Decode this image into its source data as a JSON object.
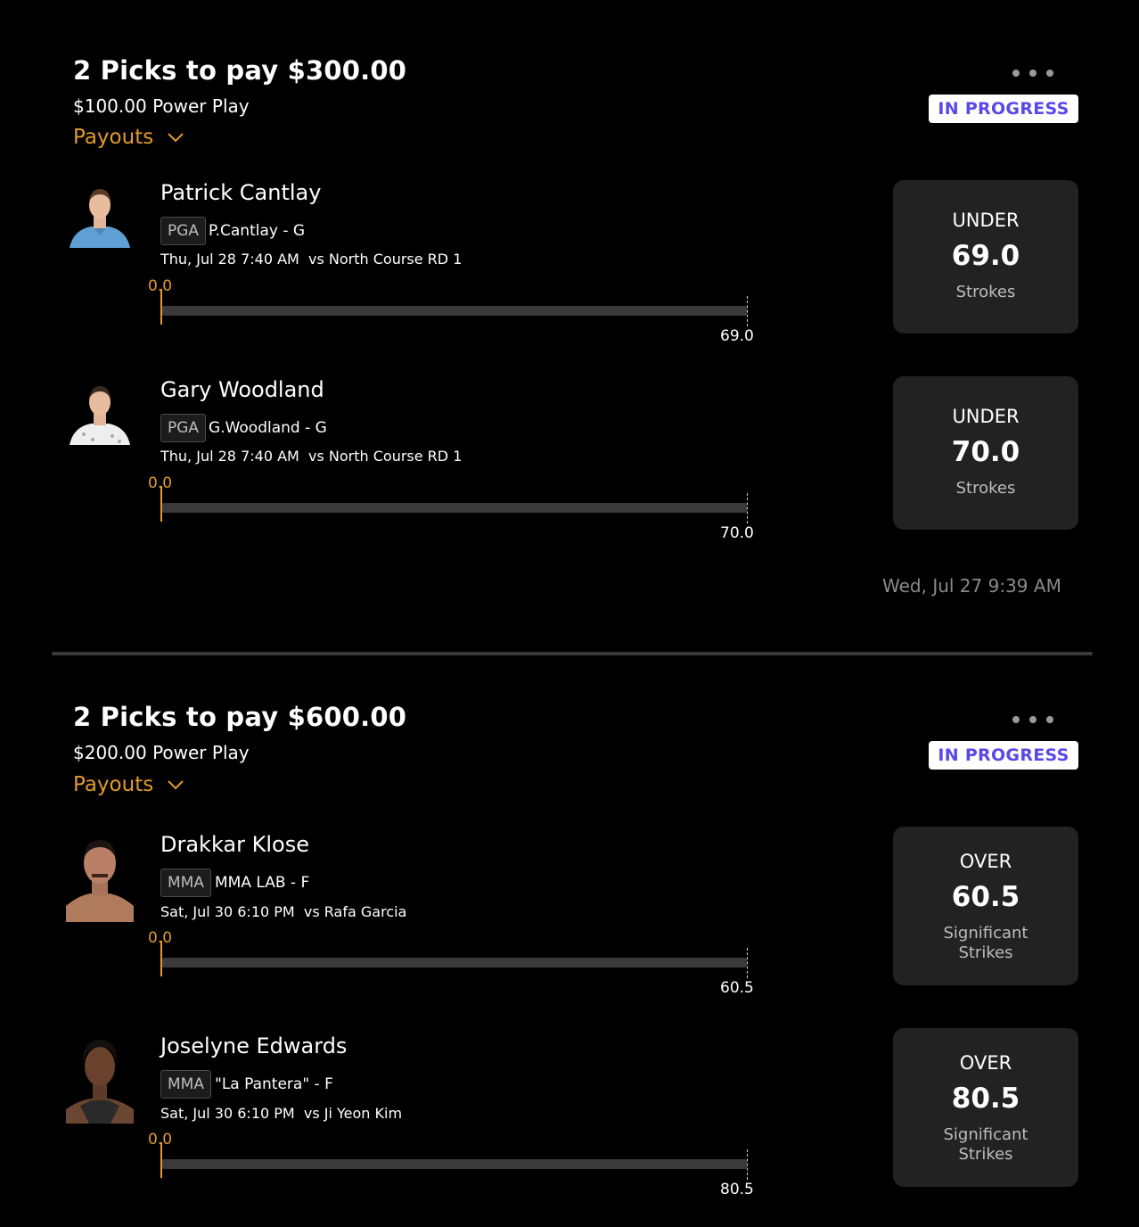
{
  "cards": [
    {
      "title": "2 Picks to pay $300.00",
      "subtitle": "$100.00 Power Play",
      "payouts_label": "Payouts",
      "status": "IN PROGRESS",
      "timestamp": "Wed, Jul 27 9:39 AM",
      "picks": [
        {
          "name": "Patrick Cantlay",
          "league": "PGA",
          "detail": "P.Cantlay - G",
          "match": "Thu, Jul 28 7:40 AM  vs North Course RD 1",
          "current": "0.0",
          "target": "69.0",
          "direction": "UNDER",
          "line": "69.0",
          "stat": "Strokes"
        },
        {
          "name": "Gary Woodland",
          "league": "PGA",
          "detail": "G.Woodland - G",
          "match": "Thu, Jul 28 7:40 AM  vs North Course RD 1",
          "current": "0.0",
          "target": "70.0",
          "direction": "UNDER",
          "line": "70.0",
          "stat": "Strokes"
        }
      ]
    },
    {
      "title": "2 Picks to pay $600.00",
      "subtitle": "$200.00 Power Play",
      "payouts_label": "Payouts",
      "status": "IN PROGRESS",
      "picks": [
        {
          "name": "Drakkar Klose",
          "league": "MMA",
          "detail": "MMA LAB - F",
          "match": "Sat, Jul 30 6:10 PM  vs Rafa Garcia",
          "current": "0.0",
          "target": "60.5",
          "direction": "OVER",
          "line": "60.5",
          "stat": "Significant Strikes"
        },
        {
          "name": "Joselyne Edwards",
          "league": "MMA",
          "detail": "\"La Pantera\" - F",
          "match": "Sat, Jul 30 6:10 PM  vs Ji Yeon Kim",
          "current": "0.0",
          "target": "80.5",
          "direction": "OVER",
          "line": "80.5",
          "stat": "Significant Strikes"
        }
      ]
    }
  ],
  "colors": {
    "background": "#000000",
    "accent_orange": "#e29a2d",
    "status_purple": "#5b48e8",
    "line_box": "#222222",
    "progress_track": "#3a3a3a"
  },
  "icons": [
    "more-options-icon",
    "chevron-down-icon",
    "player-headshot"
  ]
}
